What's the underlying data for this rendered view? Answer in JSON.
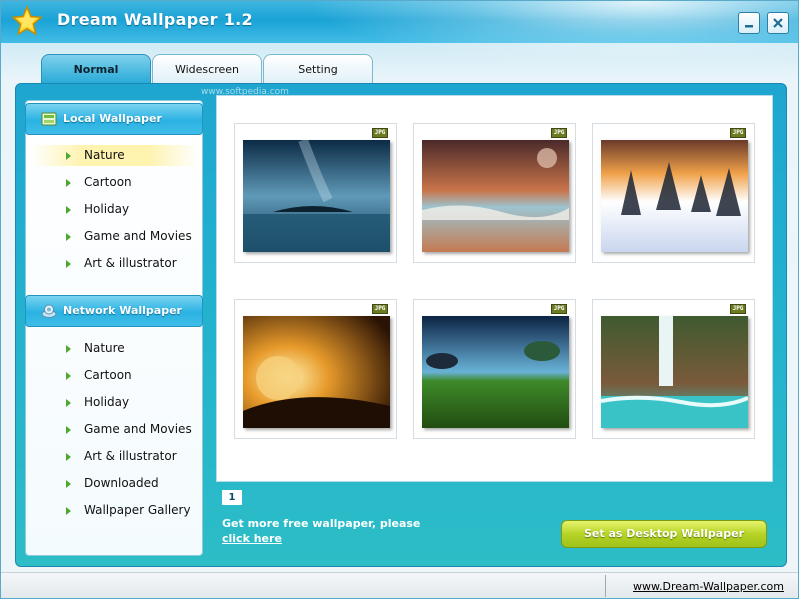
{
  "window": {
    "title": "Dream Wallpaper 1.2"
  },
  "tabs": [
    {
      "label": "Normal",
      "active": true
    },
    {
      "label": "Widescreen",
      "active": false
    },
    {
      "label": "Setting",
      "active": false
    }
  ],
  "watermark": "www.softpedia.com",
  "sidebar": {
    "local": {
      "title": "Local Wallpaper",
      "items": [
        "Nature",
        "Cartoon",
        "Holiday",
        "Game and Movies",
        "Art & illustrator"
      ],
      "selected": "Nature"
    },
    "network": {
      "title": "Network Wallpaper",
      "items": [
        "Nature",
        "Cartoon",
        "Holiday",
        "Game and Movies",
        "Art & illustrator",
        "Downloaded",
        "Wallpaper Gallery"
      ]
    }
  },
  "thumbnails": [
    {
      "badge": "JPG",
      "scene": "island-sky"
    },
    {
      "badge": "JPG",
      "scene": "sunset-beach"
    },
    {
      "badge": "JPG",
      "scene": "snowy-forest"
    },
    {
      "badge": "JPG",
      "scene": "golden-planet"
    },
    {
      "badge": "JPG",
      "scene": "fantasy-meadow"
    },
    {
      "badge": "JPG",
      "scene": "waterfall"
    }
  ],
  "pager": {
    "current_page": "1"
  },
  "promo": {
    "text": "Get more free wallpaper, please",
    "link": "click here"
  },
  "actions": {
    "set_wallpaper": "Set as Desktop Wallpaper"
  },
  "status": {
    "site": "www.Dream-Wallpaper.com"
  },
  "colors": {
    "title_bar": "#1aa3d6",
    "panel": "#22b0cf",
    "accent_button": "#b7d326",
    "nav_bullet": "#4ea72e"
  }
}
